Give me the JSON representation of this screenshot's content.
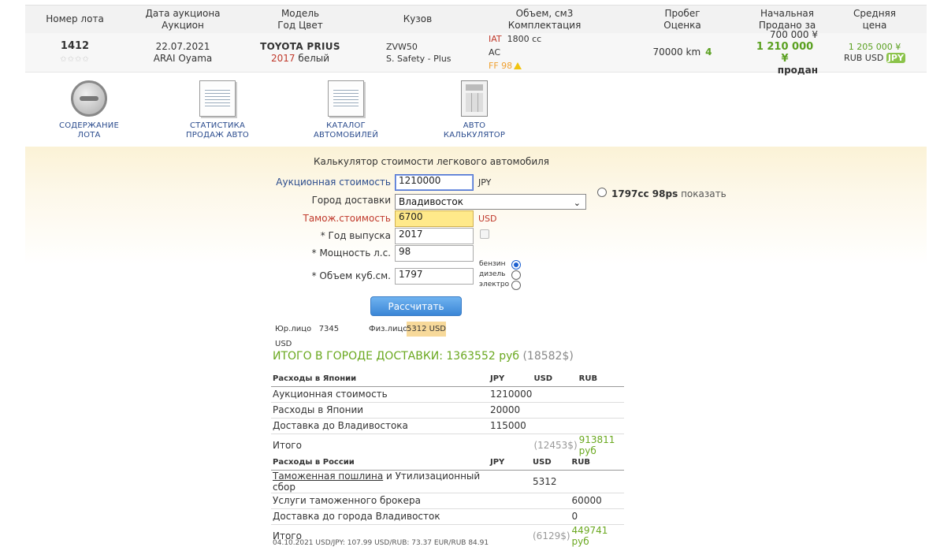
{
  "lot_table": {
    "headers": [
      [
        "Номер лота"
      ],
      [
        "Дата аукциона",
        "Аукцион"
      ],
      [
        "Модель",
        "Год Цвет"
      ],
      [
        "Кузов"
      ],
      [
        "Объем, см3",
        "Комплектация"
      ],
      [
        "Пробег",
        "Оценка"
      ],
      [
        "Начальная",
        "Продано за"
      ],
      [
        "Средняя",
        "цена"
      ]
    ],
    "lot_number": "1412",
    "auction_date": "22.07.2021",
    "auction_name": "ARAI Oyama",
    "model": "TOYOTA PRIUS",
    "year": "2017",
    "color": "белый",
    "body": "ZVW50",
    "grade_line": "S. Safety - Plus",
    "spec_transmission": "IAT",
    "spec_volume": "1800 cc",
    "spec_ac": "AC",
    "spec_ff": "FF 98",
    "mileage": "70000 km",
    "score": "4",
    "start_price": "700 000 ¥",
    "sold_price": "1 210 000 ¥",
    "sold_label": "продан",
    "avg_price": "1 205 000 ¥",
    "currency_rub": "RUB",
    "currency_usd": "USD",
    "currency_jpy": "JPY"
  },
  "nav": [
    {
      "icon": "steering-wheel-icon",
      "line1": "СОДЕРЖАНИЕ",
      "line2": "ЛОТА"
    },
    {
      "icon": "sales-stats-icon",
      "line1": "СТАТИСТИКА",
      "line2": "ПРОДАЖ АВТО"
    },
    {
      "icon": "car-catalog-icon",
      "line1": "КАТАЛОГ",
      "line2": "АВТОМОБИЛЕЙ"
    },
    {
      "icon": "calculator-icon",
      "line1": "АВТО",
      "line2": "КАЛЬКУЛЯТОР"
    }
  ],
  "calculator": {
    "title": "Калькулятор стоимости легкового автомобиля",
    "auction_cost_label": "Аукционная стоимость",
    "auction_cost_value": "1210000",
    "auction_cost_unit": "JPY",
    "city_label": "Город доставки",
    "city_value": "Владивосток",
    "customs_label": "Тамож.стоимость",
    "customs_value": "6700",
    "customs_unit": "USD",
    "year_label": "* Год выпуска",
    "year_value": "2017",
    "power_label": "* Мощность л.с.",
    "power_value": "98",
    "volume_label": "* Объем куб.см.",
    "volume_value": "1797",
    "engine_option_text": "1797cc 98ps",
    "engine_option_link": "показать",
    "fuel_gas": "бензин",
    "fuel_diesel": "дизель",
    "fuel_electric": "электро",
    "calc_button": "Рассчитать",
    "legal_label": "Юр.лицо",
    "legal_value": "7345 USD",
    "person_label": "Физ.лицо",
    "person_value": "5312 USD",
    "total_label": "ИТОГО В ГОРОДЕ ДОСТАВКИ: 1363552 руб",
    "total_usd": "(18582$)"
  },
  "japan_table": {
    "headers": [
      "Расходы в Японии",
      "JPY",
      "USD",
      "RUB"
    ],
    "rows": [
      [
        "Аукционная стоимость",
        "1210000",
        "",
        ""
      ],
      [
        "Расходы в Японии",
        "20000",
        "",
        ""
      ],
      [
        "Доставка до Владивостока",
        "115000",
        "",
        ""
      ]
    ],
    "total": [
      "Итого",
      "",
      "(12453$)",
      "913811 руб"
    ]
  },
  "russia_table": {
    "headers": [
      "Расходы в России",
      "JPY",
      "USD",
      "RUB"
    ],
    "duty_link": "Таможенная пошлина",
    "duty_rest": " и Утилизационный сбор",
    "duty_usd": "5312",
    "rows": [
      [
        "Услуги таможенного брокера",
        "",
        "",
        "60000"
      ],
      [
        "Доставка до города Владивосток",
        "",
        "",
        "0"
      ]
    ],
    "total": [
      "Итого",
      "",
      "(6129$)",
      "449741 руб"
    ]
  },
  "footnote": "04.10.2021 USD/JPY: 107.99 USD/RUB: 73.37 EUR/RUB 84.91",
  "colors": {
    "accent_green": "#6aa81f",
    "link_blue": "#2a4b8d",
    "warn_red": "#c0392b"
  }
}
